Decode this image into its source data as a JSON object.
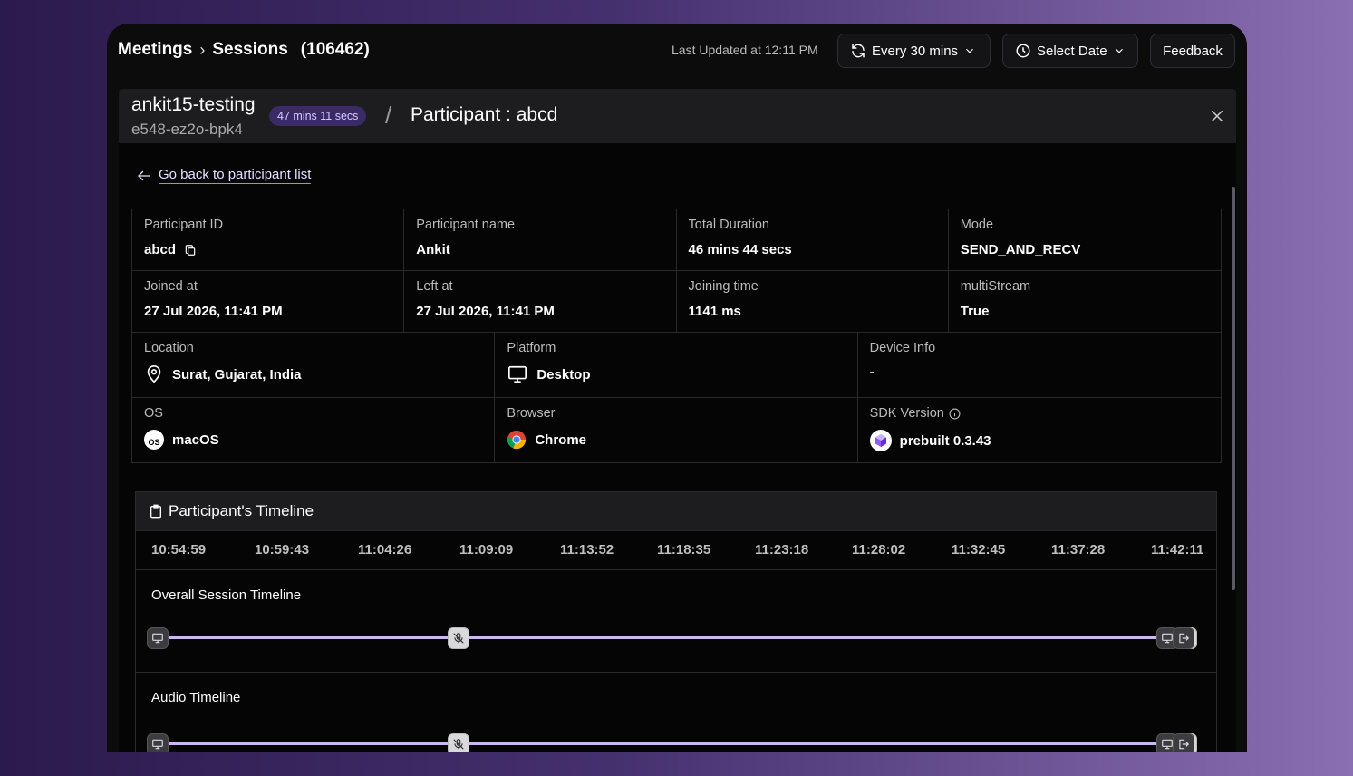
{
  "header": {
    "breadcrumb": [
      "Meetings",
      "Sessions"
    ],
    "session_count": "(106462)",
    "last_updated": "Last Updated at 12:11 PM",
    "refresh_label": "Every 30 mins",
    "date_label": "Select Date",
    "feedback_label": "Feedback"
  },
  "meeting": {
    "name": "ankit15-testing",
    "id": "e548-ez2o-bpk4",
    "duration_badge": "47 mins 11 secs",
    "participant_title": "Participant : abcd"
  },
  "back_link": "Go back to participant list",
  "details": {
    "participant_id": {
      "label": "Participant ID",
      "value": "abcd"
    },
    "participant_name": {
      "label": "Participant name",
      "value": "Ankit"
    },
    "total_duration": {
      "label": "Total Duration",
      "value": "46 mins 44 secs"
    },
    "mode": {
      "label": "Mode",
      "value": "SEND_AND_RECV"
    },
    "joined_at": {
      "label": "Joined at",
      "value": "27 Jul 2026, 11:41 PM"
    },
    "left_at": {
      "label": "Left at",
      "value": "27 Jul 2026, 11:41 PM"
    },
    "joining_time": {
      "label": "Joining time",
      "value": "1141 ms"
    },
    "multistream": {
      "label": "multiStream",
      "value": "True"
    },
    "location": {
      "label": "Location",
      "value": "Surat, Gujarat, India"
    },
    "platform": {
      "label": "Platform",
      "value": "Desktop"
    },
    "device_info": {
      "label": "Device Info",
      "value": "-"
    },
    "os": {
      "label": "OS",
      "value": "macOS",
      "logo_text": "OS"
    },
    "browser": {
      "label": "Browser",
      "value": "Chrome"
    },
    "sdk_version": {
      "label": "SDK Version",
      "value": "prebuilt 0.3.43"
    }
  },
  "timeline": {
    "title": "Participant's Timeline",
    "ticks": [
      "10:54:59",
      "10:59:43",
      "11:04:26",
      "11:09:09",
      "11:13:52",
      "11:18:35",
      "11:23:18",
      "11:28:02",
      "11:32:45",
      "11:37:28",
      "11:42:11"
    ],
    "sections": [
      {
        "title": "Overall Session Timeline"
      },
      {
        "title": "Audio Timeline"
      }
    ]
  },
  "colors": {
    "accent": "#cdb9f2",
    "badge_bg": "#3a2a66"
  }
}
